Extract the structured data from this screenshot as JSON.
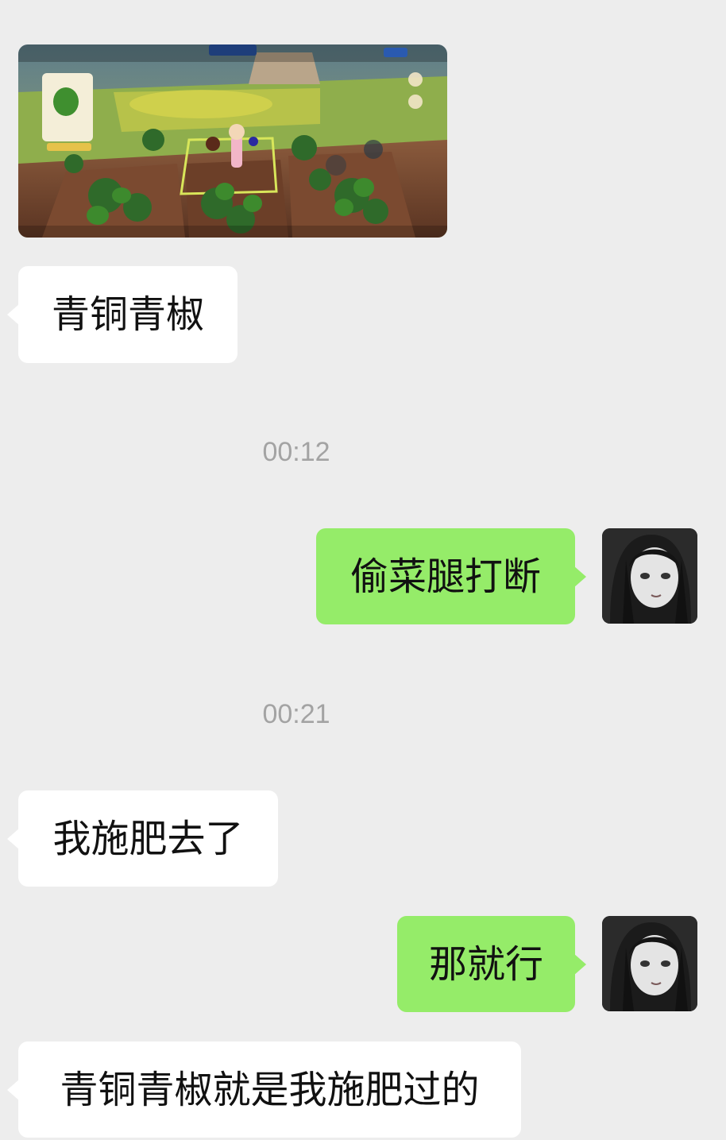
{
  "messages": [
    {
      "kind": "image",
      "sender": "other"
    },
    {
      "kind": "text",
      "sender": "other",
      "text": "青铜青椒"
    },
    {
      "kind": "time",
      "text": "00:12"
    },
    {
      "kind": "text",
      "sender": "me",
      "text": "偷菜腿打断"
    },
    {
      "kind": "time",
      "text": "00:21"
    },
    {
      "kind": "text",
      "sender": "other",
      "text": "我施肥去了"
    },
    {
      "kind": "text",
      "sender": "me",
      "text": "那就行"
    },
    {
      "kind": "text",
      "sender": "other",
      "text": "青铜青椒就是我施肥过的"
    }
  ],
  "colors": {
    "background": "#ededed",
    "bubble_in": "#ffffff",
    "bubble_out": "#95ec69",
    "timestamp": "#a3a3a3"
  },
  "icons": {
    "avatar": "dark-haired-girl-avatar"
  }
}
